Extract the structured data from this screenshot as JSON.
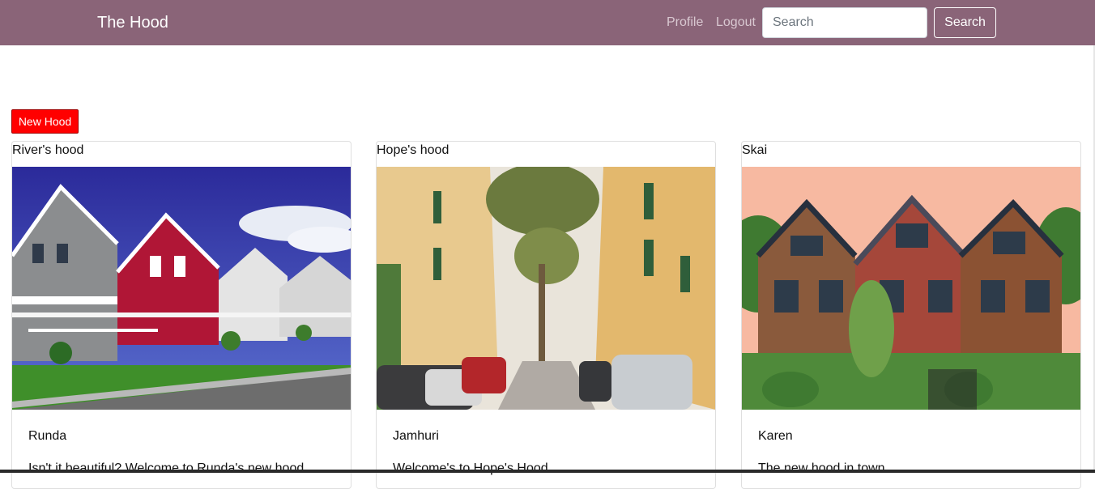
{
  "navbar": {
    "brand": "The Hood",
    "links": [
      "Profile",
      "Logout"
    ],
    "search_placeholder": "Search",
    "search_button": "Search",
    "background": "#8a6478"
  },
  "actions": {
    "new_hood_label": "New Hood",
    "new_hood_color": "#ff0000"
  },
  "hoods": [
    {
      "name": "River's hood",
      "admin": "Runda",
      "description": "Isn't it beautiful? Welcome to Runda's new hood"
    },
    {
      "name": "Hope's hood",
      "admin": "Jamhuri",
      "description": "Welcome's to Hope's Hood"
    },
    {
      "name": "Skai",
      "admin": "Karen",
      "description": "The new hood in town"
    }
  ]
}
